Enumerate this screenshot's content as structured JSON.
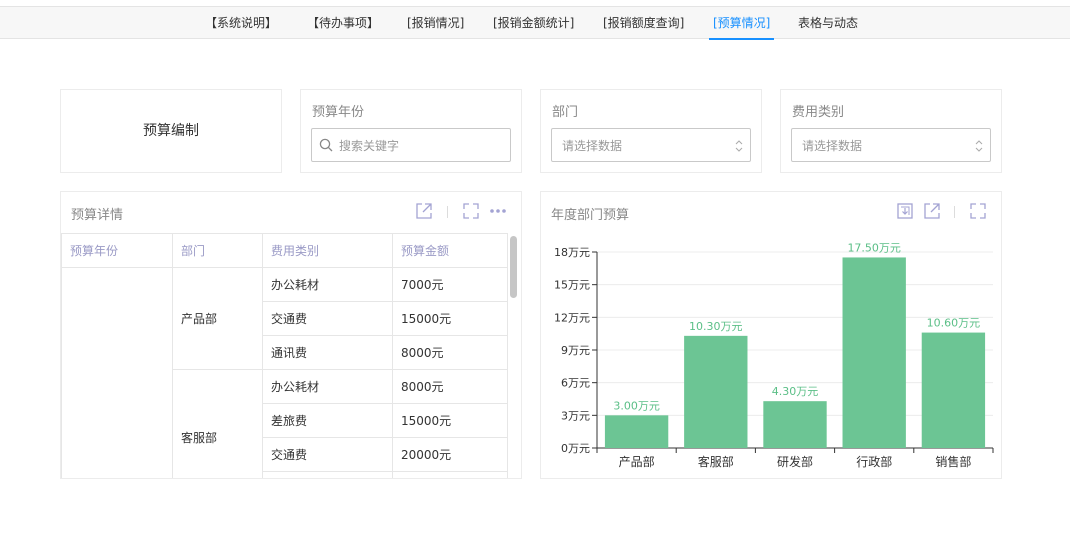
{
  "tabs": [
    {
      "label": "【系统说明】"
    },
    {
      "label": "【待办事项】"
    },
    {
      "label": "[报销情况]"
    },
    {
      "label": "[报销金额统计]"
    },
    {
      "label": "[报销额度查询]"
    },
    {
      "label": "[预算情况]"
    },
    {
      "label": "表格与动态"
    }
  ],
  "active_tab": "[预算情况]",
  "budget_card": {
    "label": "预算编制"
  },
  "filters": {
    "year": {
      "label": "预算年份",
      "placeholder": "搜索关键字"
    },
    "department": {
      "label": "部门",
      "placeholder": "请选择数据"
    },
    "expense_type": {
      "label": "费用类别",
      "placeholder": "请选择数据"
    }
  },
  "detail": {
    "title": "预算详情",
    "headers": [
      "预算年份",
      "部门",
      "费用类别",
      "预算金额"
    ],
    "groups": [
      {
        "department": "产品部",
        "rows": [
          {
            "category": "办公耗材",
            "amount": "7000元"
          },
          {
            "category": "交通费",
            "amount": "15000元"
          },
          {
            "category": "通讯费",
            "amount": "8000元"
          }
        ]
      },
      {
        "department": "客服部",
        "rows": [
          {
            "category": "办公耗材",
            "amount": "8000元"
          },
          {
            "category": "差旅费",
            "amount": "15000元"
          },
          {
            "category": "交通费",
            "amount": "20000元"
          }
        ]
      }
    ]
  },
  "chart_panel": {
    "title": "年度部门预算"
  },
  "chart_data": {
    "type": "bar",
    "categories": [
      "产品部",
      "客服部",
      "研发部",
      "行政部",
      "销售部"
    ],
    "values": [
      3.0,
      10.3,
      4.3,
      17.5,
      10.6
    ],
    "data_labels": [
      "3.00万元",
      "10.30万元",
      "4.30万元",
      "17.50万元",
      "10.60万元"
    ],
    "y_ticks": [
      "0万元",
      "3万元",
      "6万元",
      "9万元",
      "12万元",
      "15万元",
      "18万元"
    ],
    "ylim": [
      0,
      18
    ],
    "grid": true,
    "bar_color": "#6cc594",
    "label_color": "#5bbf87"
  },
  "colors": {
    "accent": "#1890ff",
    "header_text": "#9a9ac6"
  }
}
